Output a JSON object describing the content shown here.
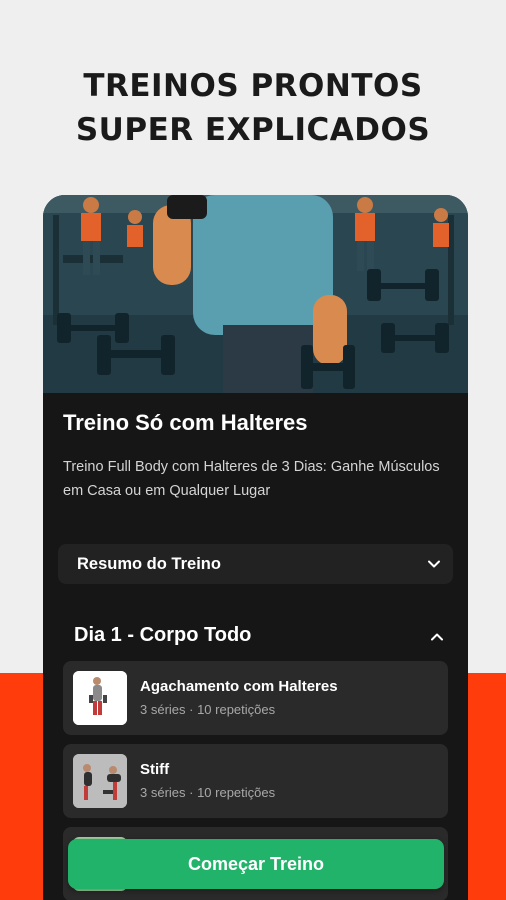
{
  "headline": {
    "line1": "TREINOS PRONTOS",
    "line2": "SUPER EXPLICADOS"
  },
  "workout": {
    "title": "Treino Só com Halteres",
    "description": "Treino Full Body com Halteres de 3 Dias: Ganhe Músculos em Casa ou em Qualquer Lugar"
  },
  "summary": {
    "label": "Resumo do Treino",
    "icon": "chevron-down-icon"
  },
  "day": {
    "title": "Dia 1 - Corpo Todo",
    "icon": "chevron-up-icon"
  },
  "exercises": [
    {
      "name": "Agachamento com Halteres",
      "meta": "3 séries · 10 repetições"
    },
    {
      "name": "Stiff",
      "meta": "3 séries · 10 repetições"
    },
    {
      "name": "",
      "meta": ""
    }
  ],
  "cta": {
    "label": "Começar Treino"
  },
  "colors": {
    "accent_orange": "#ff3d0c",
    "cta_green": "#22b36b",
    "card_dark": "#161616",
    "page_bg": "#efefef"
  }
}
